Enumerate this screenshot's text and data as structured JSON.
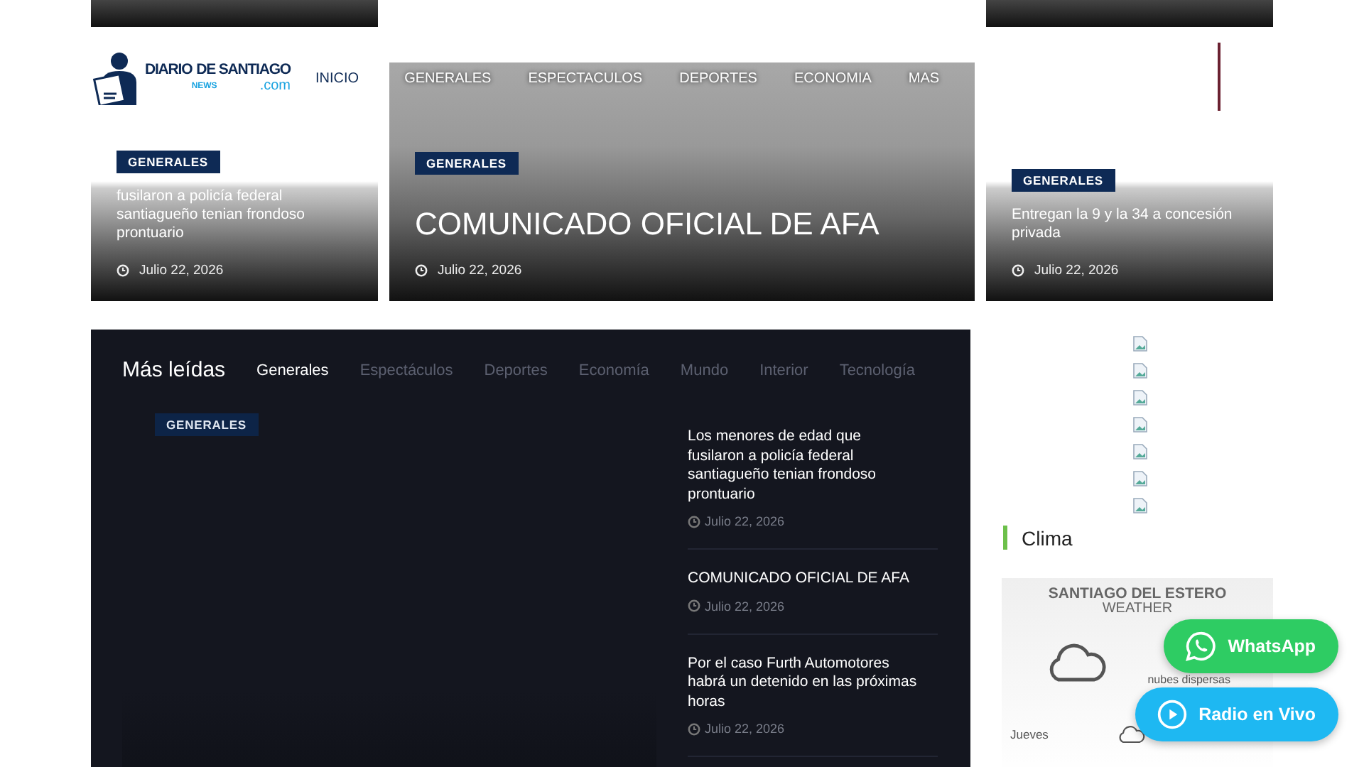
{
  "header": {
    "logo": {
      "word1": "DIARIO",
      "word2": "DE SANTIAGO",
      "domain": ".com",
      "paper": "NEWS"
    },
    "nav": [
      "INICIO",
      "GENERALES",
      "ESPECTACULOS",
      "DEPORTES",
      "ECONOMIA",
      "MAS"
    ]
  },
  "hero_cards": [
    {
      "kind": "small",
      "category": "GENERALES",
      "title": "fusilaron a policía federal santiagueño tenian frondoso prontuario",
      "date": "Julio 22, 2026"
    },
    {
      "kind": "large",
      "category": "GENERALES",
      "title": "COMUNICADO OFICIAL DE AFA",
      "date": "Julio 22, 2026"
    },
    {
      "kind": "small",
      "category": "GENERALES",
      "title": "Entregan la 9 y la 34 a concesión privada",
      "date": "Julio 22, 2026"
    }
  ],
  "most_read": {
    "title": "Más leídas",
    "tabs": [
      {
        "label": "Generales",
        "selected": true
      },
      {
        "label": "Espectáculos",
        "selected": false
      },
      {
        "label": "Deportes",
        "selected": false
      },
      {
        "label": "Economía",
        "selected": false
      },
      {
        "label": "Mundo",
        "selected": false
      },
      {
        "label": "Interior",
        "selected": false
      },
      {
        "label": "Tecnología",
        "selected": false
      }
    ],
    "featured": {
      "category": "GENERALES"
    },
    "items": [
      {
        "title": "Los menores de edad que fusilaron a policía federal santiagueño tenian frondoso prontuario",
        "date": "Julio 22, 2026"
      },
      {
        "title": "COMUNICADO OFICIAL DE AFA",
        "date": "Julio 22, 2026"
      },
      {
        "title": "Por el caso Furth Automotores habrá un detenido en las próximas horas",
        "date": "Julio 22, 2026"
      }
    ]
  },
  "sidebar": {
    "heading": "Clima",
    "weather": {
      "city": "SANTIAGO DEL ESTERO",
      "subtitle": "WEATHER",
      "description": "nubes dispersas",
      "day": "Jueves"
    }
  },
  "floating_buttons": [
    {
      "kind": "whatsapp",
      "label": "WhatsApp"
    },
    {
      "kind": "radio",
      "label": "Radio en Vivo"
    }
  ]
}
